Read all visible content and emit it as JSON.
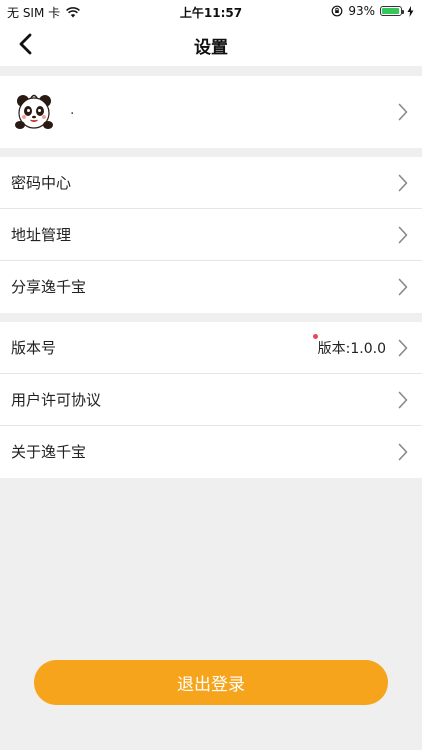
{
  "status_bar": {
    "carrier": "无 SIM 卡",
    "time": "上午11:57",
    "battery_percent": "93%",
    "battery_level": 0.93,
    "icons": [
      "wifi-icon",
      "orientation-lock-icon",
      "battery-icon",
      "charging-icon"
    ]
  },
  "navbar": {
    "title": "设置",
    "back_icon": "chevron-left-icon"
  },
  "profile": {
    "name": ".",
    "avatar_icon": "panda-avatar"
  },
  "groups": [
    {
      "items": [
        {
          "label": "密码中心"
        },
        {
          "label": "地址管理"
        },
        {
          "label": "分享逸千宝"
        }
      ]
    },
    {
      "items": [
        {
          "label": "版本号",
          "value": "版本:1.0.0",
          "badge": "red-dot"
        },
        {
          "label": "用户许可协议"
        },
        {
          "label": "关于逸千宝"
        }
      ]
    }
  ],
  "logout_button": {
    "label": "退出登录"
  },
  "colors": {
    "accent": "#f6a41b",
    "background": "#efefef",
    "badge": "#e8485a"
  }
}
